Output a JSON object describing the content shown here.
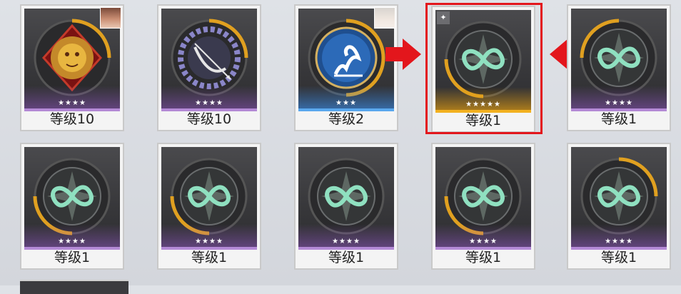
{
  "cards": [
    {
      "level": "等级10",
      "stars": "★★★★",
      "emblem": "lion-emblem"
    },
    {
      "level": "等级10",
      "stars": "★★★★",
      "emblem": "bow-emblem"
    },
    {
      "level": "等级2",
      "stars": "★★★",
      "emblem": "swan-emblem"
    },
    {
      "level": "等级1",
      "stars": "★★★★★",
      "emblem": "infinity-emblem"
    },
    {
      "level": "等级1",
      "stars": "★★★★",
      "emblem": "infinity-emblem"
    },
    {
      "level": "等级1",
      "stars": "★★★★",
      "emblem": "infinity-emblem"
    },
    {
      "level": "等级1",
      "stars": "★★★★",
      "emblem": "infinity-emblem"
    },
    {
      "level": "等级1",
      "stars": "★★★★",
      "emblem": "infinity-emblem"
    },
    {
      "level": "等级1",
      "stars": "★★★★",
      "emblem": "infinity-emblem"
    },
    {
      "level": "等级1",
      "stars": "★★★★",
      "emblem": "infinity-emblem"
    }
  ],
  "colors": {
    "highlight": "#e3161c",
    "arrow": "#e3161c",
    "gold": "#f2b120",
    "purple": "#b48ad6",
    "blue": "#5aa8ee"
  }
}
